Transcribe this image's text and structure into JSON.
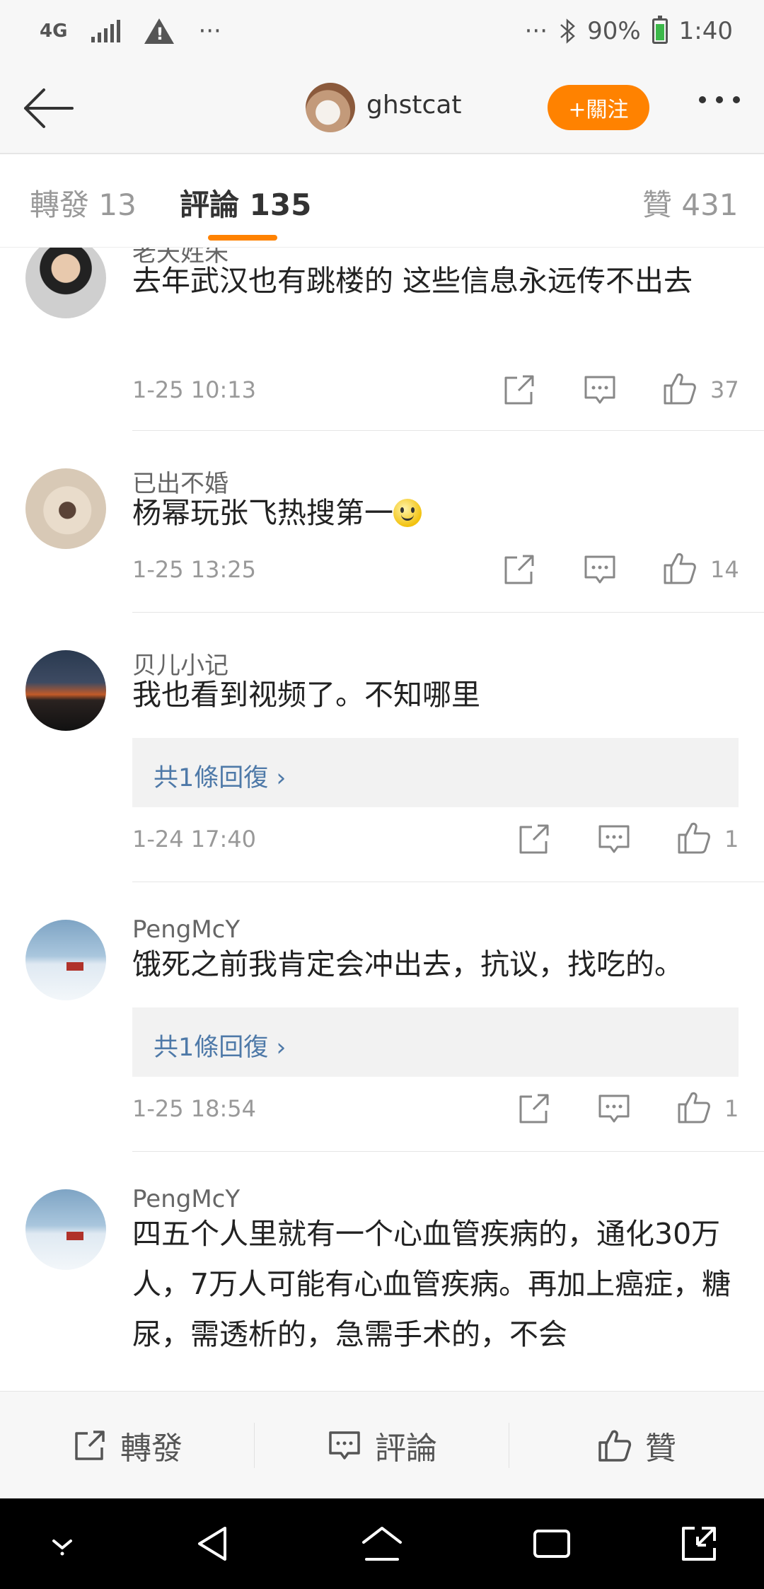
{
  "status_bar": {
    "network": "4G",
    "dots_left": "···",
    "dots_right": "···",
    "battery": "90%",
    "time": "1:40"
  },
  "header": {
    "username": "ghstcat",
    "follow_label": "+關注"
  },
  "tabs": {
    "repost": "轉發 13",
    "comments": "評論 135",
    "likes": "贊 431"
  },
  "comments": [
    {
      "username": "老天姓朱",
      "text": "去年武汉也有跳楼的 这些信息永远传不出去",
      "time": "1-25 10:13",
      "likes": "37"
    },
    {
      "username": "已出不婚",
      "text": "杨幂玩张飞热搜第一",
      "time": "1-25 13:25",
      "likes": "14"
    },
    {
      "username": "贝儿小记",
      "text": "我也看到视频了。不知哪里",
      "reply": "共1條回復 ›",
      "time": "1-24 17:40",
      "likes": "1"
    },
    {
      "username": "PengMcY",
      "text": "饿死之前我肯定会冲出去，抗议，找吃的。",
      "reply": "共1條回復 ›",
      "time": "1-25 18:54",
      "likes": "1"
    },
    {
      "username": "PengMcY",
      "text": "四五个人里就有一个心血管疾病的，通化30万人，7万人可能有心血管疾病。再加上癌症，糖尿，需透析的，急需手术的，不会"
    }
  ],
  "bottom_bar": {
    "repost": "轉發",
    "comment": "評論",
    "like": "贊"
  },
  "colors": {
    "accent": "#ff8200",
    "reply_link": "#4e79a8"
  }
}
